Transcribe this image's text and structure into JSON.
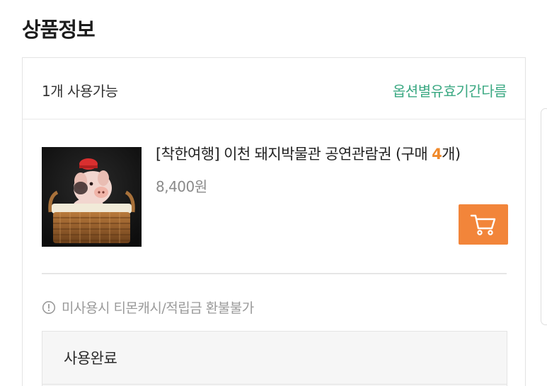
{
  "section": {
    "title": "상품정보"
  },
  "card": {
    "availability": "1개 사용가능",
    "validity_link": "옵션별유효기간다름",
    "product": {
      "title_prefix": "[착한여행] 이천 돼지박물관 공연관람권 (구매 ",
      "quantity": "4",
      "title_suffix": "개)",
      "price": "8,400원",
      "thumbnail": "pig-in-basket-photo",
      "cart_icon": "cart-icon"
    },
    "notice": {
      "icon": "info-icon",
      "text": "미사용시 티몬캐시/적립금 환불불가"
    },
    "status": {
      "label": "사용완료"
    }
  },
  "colors": {
    "accent_green": "#3aa882",
    "accent_orange": "#f2853a",
    "quantity_orange": "#f08a2c"
  }
}
